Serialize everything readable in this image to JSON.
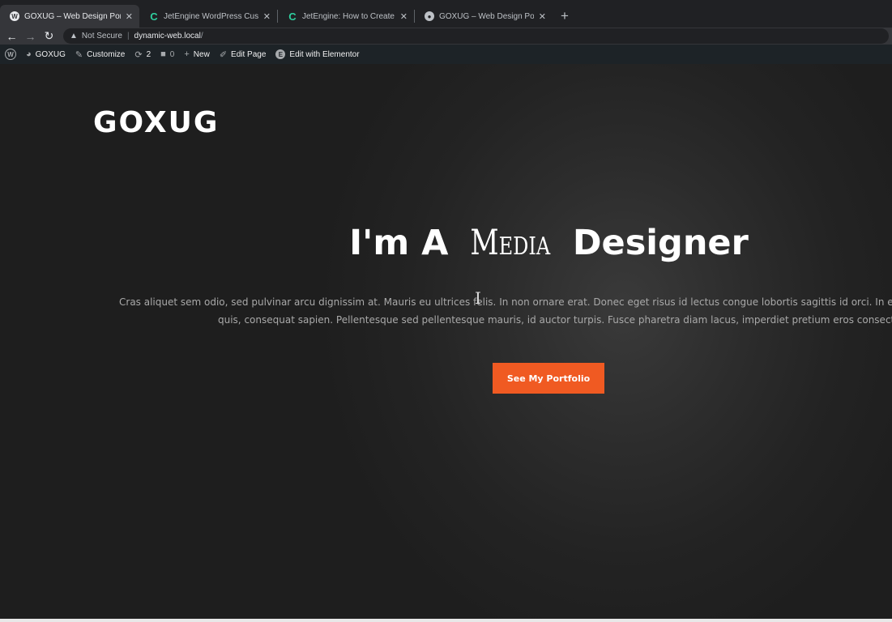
{
  "browser": {
    "tabs": [
      {
        "title": "GOXUG – Web Design Portfolio",
        "icon": "wordpress-icon",
        "active": true
      },
      {
        "title": "JetEngine WordPress Custom",
        "icon": "jetengine-icon",
        "active": false
      },
      {
        "title": "JetEngine: How to Create Cust",
        "icon": "jetengine-icon",
        "active": false
      },
      {
        "title": "GOXUG – Web Design Portfolio",
        "icon": "globe-icon",
        "active": false
      }
    ],
    "new_tab": "+",
    "address": {
      "security": "Not Secure",
      "host": "dynamic-web.local",
      "path": "/"
    }
  },
  "adminbar": {
    "site_name": "GOXUG",
    "customize": "Customize",
    "updates_count": "2",
    "comments_count": "0",
    "new": "New",
    "edit_page": "Edit Page",
    "edit_elementor": "Edit with Elementor"
  },
  "hero": {
    "logo": "GOXUG",
    "headline_pre": "I'm A ",
    "headline_accent": "Media",
    "headline_post": " Designer",
    "desc_line1": "Cras aliquet sem odio, sed pulvinar arcu dignissim at. Mauris eu ultrices felis. In non ornare erat. Donec eget risus id lectus congue lobortis sagittis id orci. In eget enim ele",
    "desc_line2": "quis, consequat sapien. Pellentesque sed pellentesque mauris, id auctor turpis. Fusce pharetra diam lacus, imperdiet pretium eros consectetur id.",
    "cta": "See My Portfolio"
  },
  "colors": {
    "accent": "#f05a22",
    "adminbar": "#1d2327",
    "tabbar": "#202124"
  }
}
